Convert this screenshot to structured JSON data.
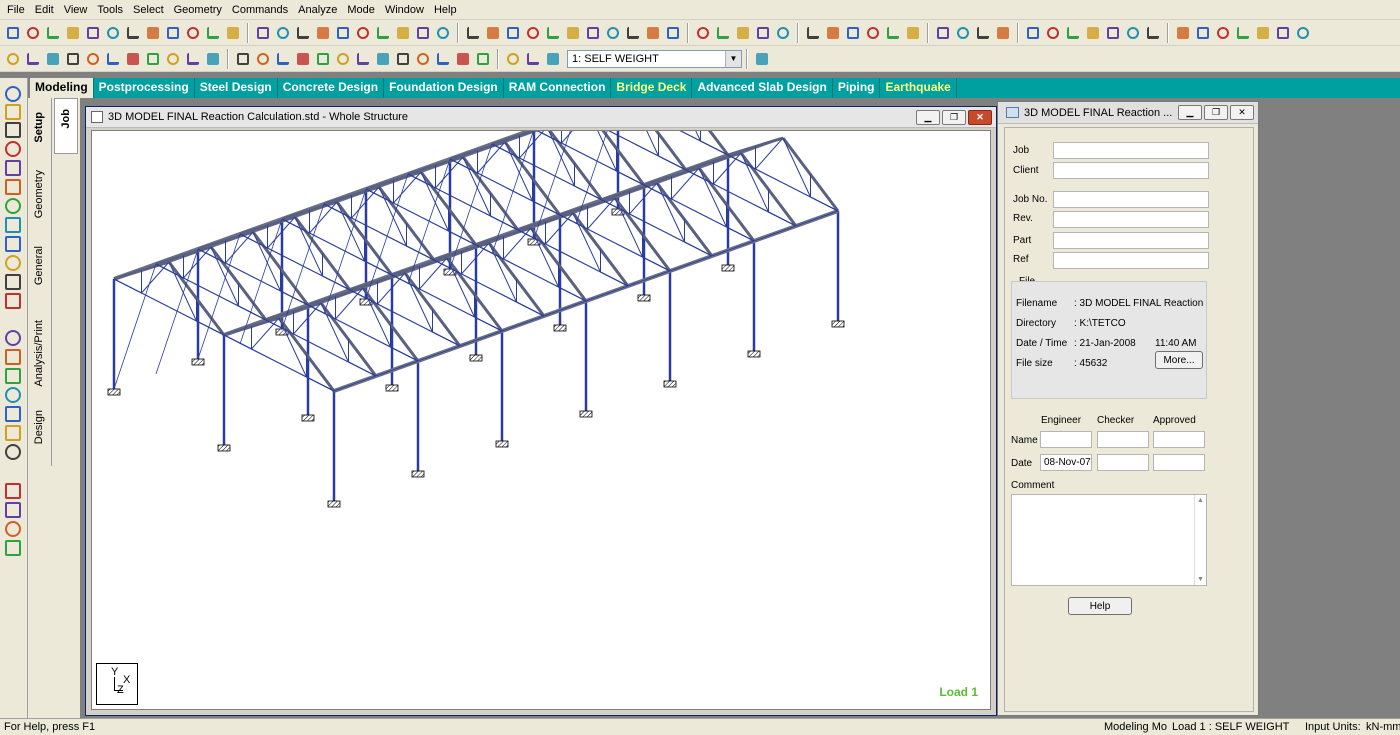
{
  "menu": [
    "File",
    "Edit",
    "View",
    "Tools",
    "Select",
    "Geometry",
    "Commands",
    "Analyze",
    "Mode",
    "Window",
    "Help"
  ],
  "toolbar": {
    "load_case": "1: SELF WEIGHT"
  },
  "page_tabs": [
    "Modeling",
    "Postprocessing",
    "Steel Design",
    "Concrete Design",
    "Foundation Design",
    "RAM Connection",
    "Bridge Deck",
    "Advanced Slab Design",
    "Piping",
    "Earthquake"
  ],
  "side_tabs": {
    "job": "Job",
    "setup": "Setup",
    "geometry": "Geometry",
    "general": "General",
    "analysis": "Analysis/Print",
    "design": "Design"
  },
  "main_window": {
    "title": "3D MODEL FINAL Reaction Calculation.std - Whole Structure",
    "load_label": "Load 1",
    "axes": {
      "y": "Y",
      "x": "X",
      "z": "Z"
    }
  },
  "job_window": {
    "title": "3D MODEL FINAL Reaction ...",
    "labels": {
      "job": "Job",
      "client": "Client",
      "job_no": "Job No.",
      "rev": "Rev.",
      "part": "Part",
      "ref": "Ref",
      "file": "File",
      "filename": "Filename",
      "directory": "Directory",
      "datetime": "Date / Time",
      "filesize": "File size",
      "engineer": "Engineer",
      "checker": "Checker",
      "approved": "Approved",
      "name": "Name",
      "date": "Date",
      "comment": "Comment"
    },
    "values": {
      "filename": ": 3D MODEL FINAL Reaction",
      "directory": ": K:\\TETCO",
      "date": ": 21-Jan-2008",
      "time": "11:40 AM",
      "filesize": ": 45632",
      "engineer_date": "08-Nov-07"
    },
    "buttons": {
      "more": "More...",
      "help": "Help"
    }
  },
  "status": {
    "help": "For Help, press F1",
    "mode": "Modeling Mo",
    "load": "Load 1 : SELF WEIGHT",
    "units": "Input Units:",
    "units_value": "kN-mm"
  },
  "colors": {
    "tabbar": "#00a0a0",
    "structure": "#2a3d9c",
    "load_label": "#5dbb3c"
  }
}
